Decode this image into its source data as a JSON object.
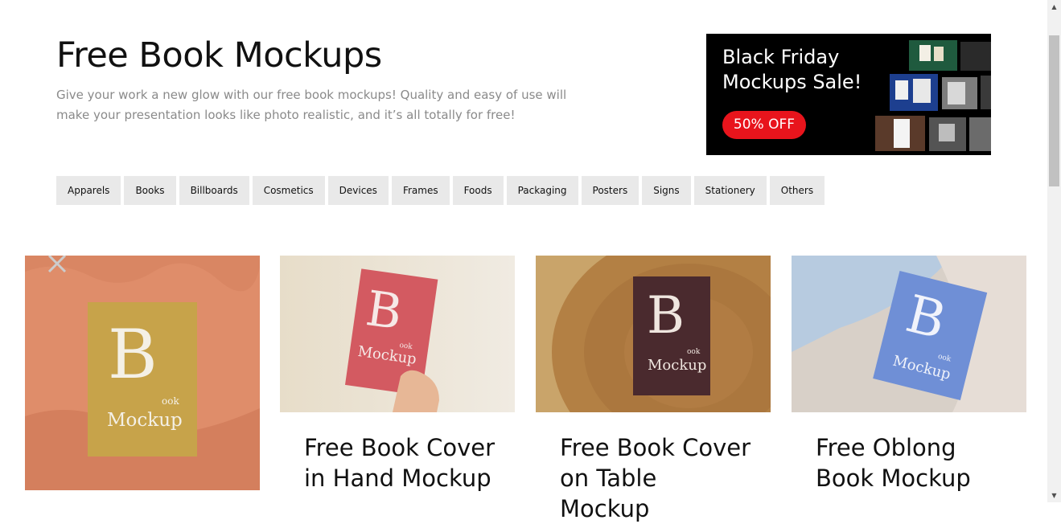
{
  "header": {
    "title": "Free Book Mockups",
    "description": "Give your work a new glow with our free book mockups! Quality and easy of use will make your presentation looks like photo realistic, and it’s all totally for free!"
  },
  "banner": {
    "title_line1": "Black Friday",
    "title_line2": "Mockups Sale!",
    "badge": "50% OFF"
  },
  "categories": [
    "Apparels",
    "Books",
    "Billboards",
    "Cosmetics",
    "Devices",
    "Frames",
    "Foods",
    "Packaging",
    "Posters",
    "Signs",
    "Stationery",
    "Others"
  ],
  "cards": [
    {
      "title": "",
      "book_letter": "B",
      "book_small": "ook",
      "book_word": "Mockup"
    },
    {
      "title": "Free Book Cover in Hand Mockup",
      "book_letter": "B",
      "book_small": "ook",
      "book_word": "Mockup"
    },
    {
      "title": "Free Book Cover on Table Mockup",
      "book_letter": "B",
      "book_small": "ook",
      "book_word": "Mockup"
    },
    {
      "title": "Free Oblong Book Mockup",
      "book_letter": "B",
      "book_small": "ook",
      "book_word": "Mockup"
    }
  ],
  "colors": {
    "banner_bg": "#000000",
    "badge": "#e8141c",
    "category_bg": "#e9e9e9",
    "book1": "#c7a34a",
    "book2": "#d35a61",
    "book3": "#4a2a2e",
    "book4": "#6f8fd6"
  }
}
